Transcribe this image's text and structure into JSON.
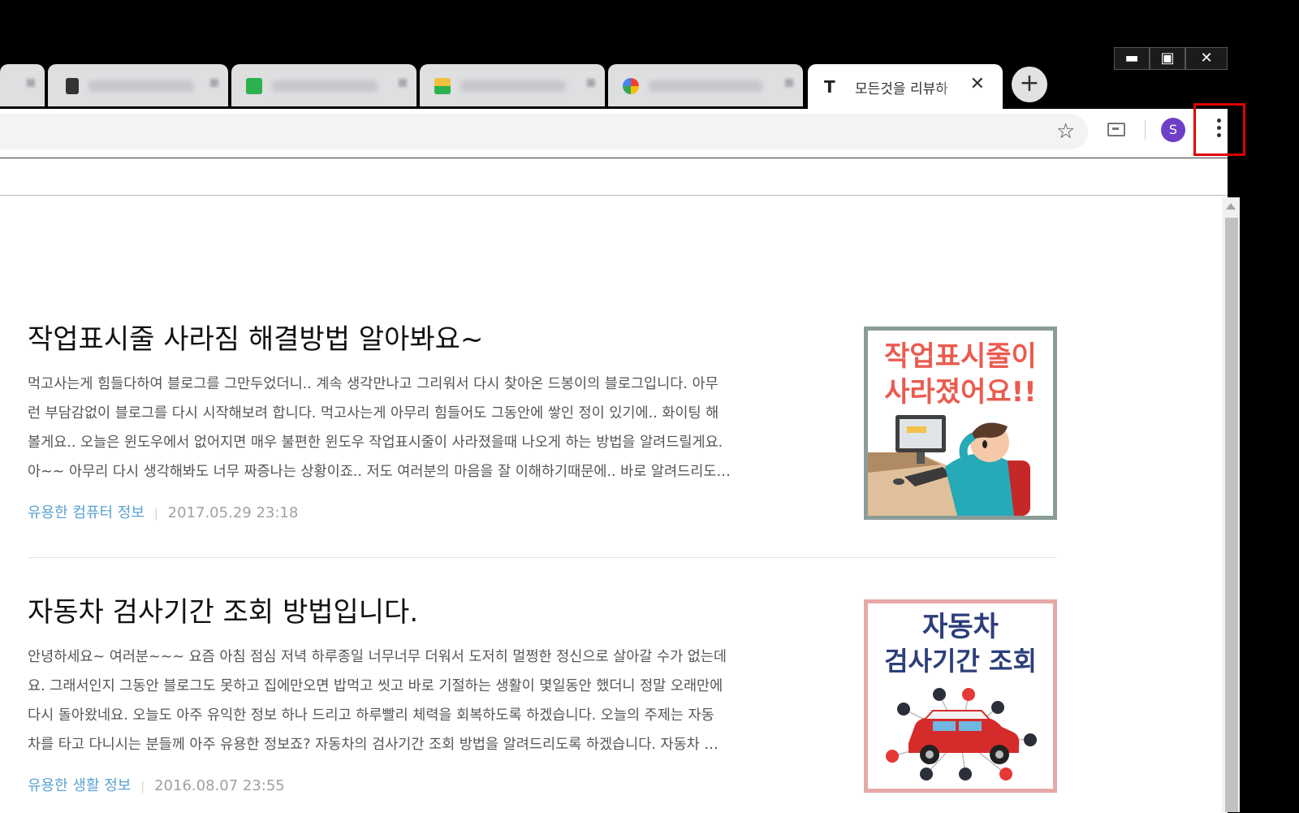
{
  "browser": {
    "window_controls": {
      "minimize": "▬",
      "maximize": "▣",
      "close": "✕"
    },
    "active_tab": {
      "favicon": "T",
      "title": "모든것을 리뷰하",
      "close": "✕"
    },
    "new_tab_label": "+",
    "toolbar": {
      "star_icon": "☆",
      "avatar_letter": "S"
    }
  },
  "posts": [
    {
      "title": "작업표시줄 사라짐 해결방법 알아봐요~",
      "excerpt_lines": [
        "먹고사는게 힘들다하여 블로그를 그만두었더니.. 계속 생각만나고 그리워서 다시 찾아온 드봉이의 블로그입니다. 아무",
        "런 부담감없이 블로그를 다시 시작해보려 합니다. 먹고사는게 아무리 힘들어도 그동안에 쌓인 정이 있기에.. 화이팅 해",
        "볼게요.. 오늘은 윈도우에서 없어지면 매우 불편한 윈도우 작업표시줄이 사라졌을때 나오게 하는 방법을 알려드릴게요.",
        "아~~ 아무리 다시 생각해봐도 너무 짜증나는 상황이죠.. 저도 여러분의 마음을 잘 이해하기때문에.. 바로 알려드리도…"
      ],
      "category": "유용한 컴퓨터 정보",
      "date": "2017.05.29 23:18",
      "thumb_lines": [
        "작업표시줄이",
        "사라졌어요!!"
      ]
    },
    {
      "title": "자동차 검사기간 조회 방법입니다.",
      "excerpt_lines": [
        "안녕하세요~ 여러분~~~ 요즘 아침 점심 저녁 하루종일 너무너무 더워서 도저히 멀쩡한 정신으로 살아갈 수가 없는데",
        "요. 그래서인지 그동안 블로그도 못하고 집에만오면 밥먹고 씻고 바로 기절하는 생활이 몇일동안 했더니 정말 오래만에",
        "다시 돌아왔네요. 오늘도 아주 유익한 정보 하나 드리고 하루빨리 체력을 회복하도록 하겠습니다. 오늘의 주제는 자동",
        "차를 타고 다니시는 분들께 아주 유용한 정보죠? 자동차의 검사기간 조회 방법을 알려드리도록 하겠습니다. 자동차 …"
      ],
      "category": "유용한 생활 정보",
      "date": "2016.08.07 23:55",
      "thumb_lines": [
        "자동차",
        "검사기간 조회"
      ]
    }
  ]
}
